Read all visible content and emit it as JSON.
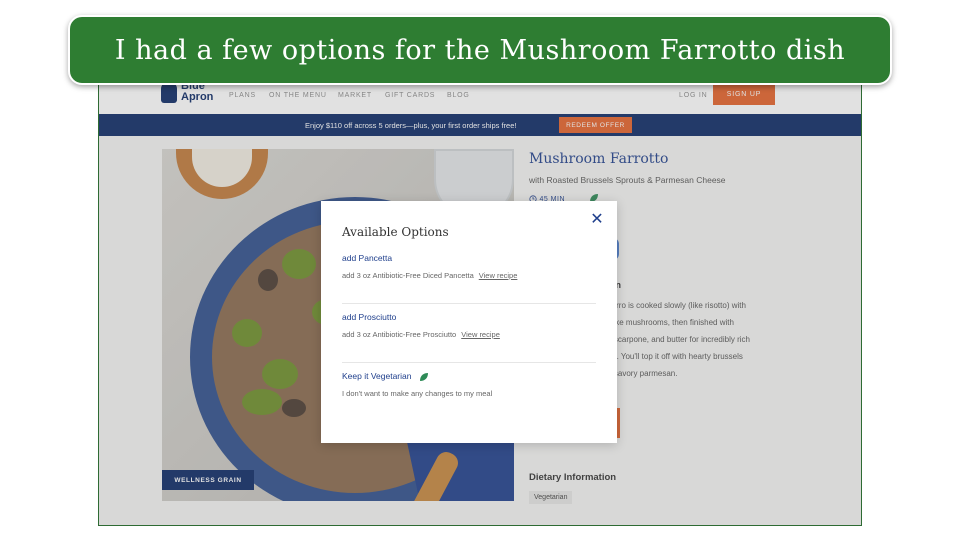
{
  "banner": {
    "text": "I had a few options for the Mushroom Farrotto dish"
  },
  "navbar": {
    "logo_text_1": "Blue",
    "logo_text_2": "Apron",
    "links": [
      "PLANS",
      "ON THE MENU",
      "MARKET",
      "GIFT CARDS",
      "BLOG"
    ],
    "login": "LOG IN",
    "signup": "SIGN UP"
  },
  "promo": {
    "text": "Enjoy $110 off across 5 orders—plus, your first order ships free!",
    "button": "REDEEM OFFER"
  },
  "recipe": {
    "title": "Mushroom Farrotto",
    "subtitle": "with Roasted Brussels Sprouts & Parmesan Cheese",
    "time": "45 MIN",
    "kitchen_heading": "hen",
    "description_lines": [
      ", farro is cooked slowly (like risotto) with",
      "iitake mushrooms, then finished with",
      "nascarpone, and butter for incredibly rich",
      "ure. You'll top it off with hearty brussels",
      "of savory parmesan."
    ],
    "card_link": "RD",
    "image_badge": "WELLNESS GRAIN",
    "dietary_heading": "Dietary Information",
    "dietary_tag": "Vegetarian"
  },
  "modal": {
    "title": "Available Options",
    "options": [
      {
        "title": "add Pancetta",
        "description": "add 3 oz Antibiotic-Free Diced Pancetta",
        "link": "View recipe"
      },
      {
        "title": "add Prosciutto",
        "description": "add 3 oz Antibiotic-Free Prosciutto",
        "link": "View recipe"
      },
      {
        "title": "Keep it Vegetarian",
        "description": "I don't want to make any changes to my meal",
        "link": ""
      }
    ]
  },
  "colors": {
    "navy": "#0c2a66",
    "orange": "#e4622a",
    "banner_green": "#2e7d32",
    "leaf_green": "#2e8b57"
  },
  "icons": {
    "close": "close-icon",
    "leaf": "leaf-icon",
    "clock": "clock-icon",
    "logo": "blue-apron-logo-icon"
  }
}
